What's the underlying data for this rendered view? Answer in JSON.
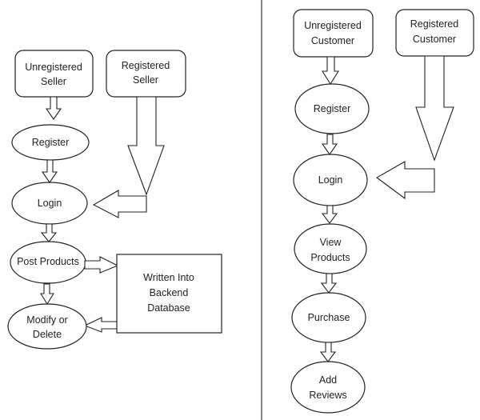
{
  "seller_flow": {
    "unregistered_seller": [
      "Unregistered",
      "Seller"
    ],
    "registered_seller": [
      "Registered",
      "Seller"
    ],
    "register": "Register",
    "login": "Login",
    "post_products": "Post Products",
    "modify_delete": [
      "Modify or",
      "Delete"
    ],
    "database": [
      "Written Into",
      "Backend",
      "Database"
    ]
  },
  "customer_flow": {
    "unregistered_customer": [
      "Unregistered",
      "Customer"
    ],
    "registered_customer": [
      "Registered",
      "Customer"
    ],
    "register": "Register",
    "login": "Login",
    "view_products": [
      "View",
      "Products"
    ],
    "purchase": "Purchase",
    "add_reviews": [
      "Add",
      "Reviews"
    ]
  }
}
